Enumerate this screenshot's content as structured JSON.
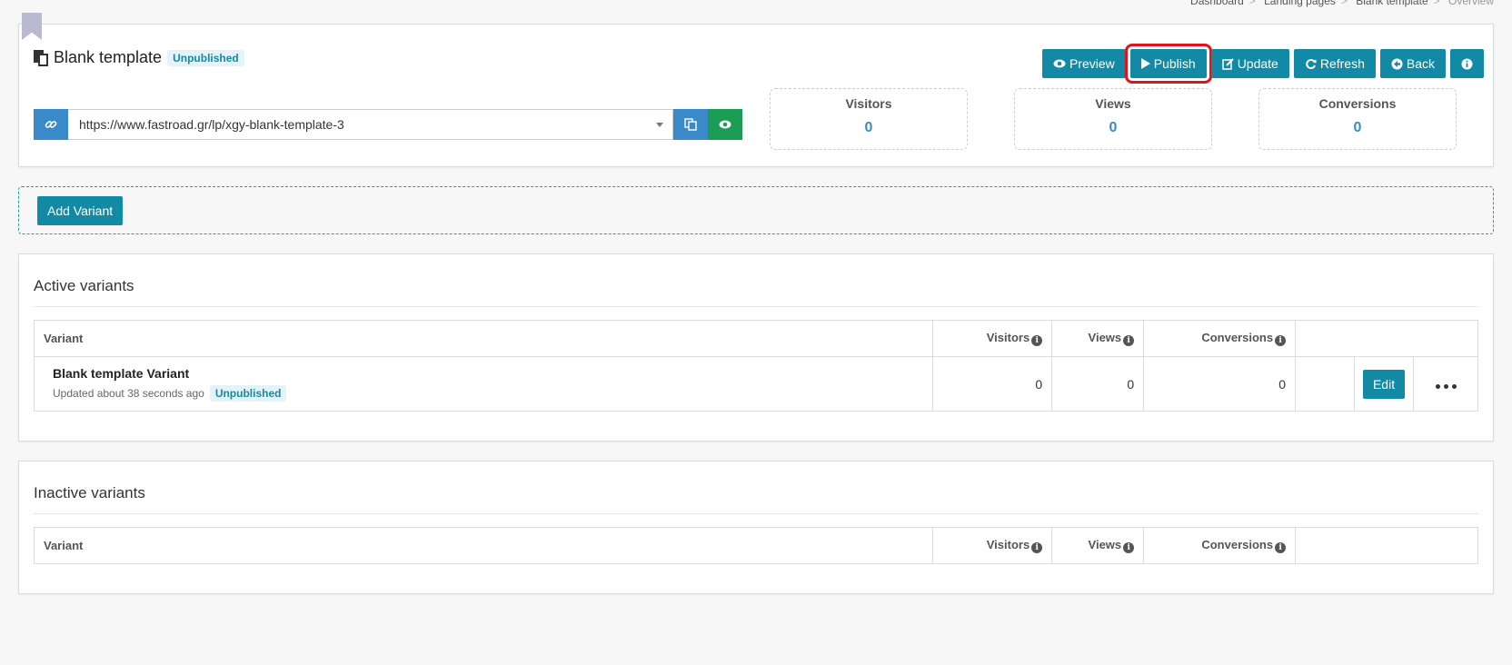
{
  "breadcrumb": [
    "Dashboard",
    "Landing pages",
    "Blank template",
    "Overview"
  ],
  "header": {
    "title": "Blank template",
    "status": "Unpublished",
    "buttons": {
      "preview": "Preview",
      "publish": "Publish",
      "update": "Update",
      "refresh": "Refresh",
      "back": "Back"
    },
    "url": "https://www.fastroad.gr/lp/xgy-blank-template-3"
  },
  "stats": [
    {
      "label": "Visitors",
      "value": "0"
    },
    {
      "label": "Views",
      "value": "0"
    },
    {
      "label": "Conversions",
      "value": "0"
    }
  ],
  "add_variant_label": "Add Variant",
  "columns": {
    "variant": "Variant",
    "visitors": "Visitors",
    "views": "Views",
    "conversions": "Conversions"
  },
  "active": {
    "title": "Active variants",
    "rows": [
      {
        "name": "Blank template Variant",
        "updated": "Updated about 38 seconds ago",
        "status": "Unpublished",
        "visitors": "0",
        "views": "0",
        "conversions": "0",
        "edit_label": "Edit"
      }
    ]
  },
  "inactive": {
    "title": "Inactive variants"
  },
  "colors": {
    "primary": "#128aa6",
    "link_blue": "#3a8ac9",
    "green": "#1b9d55",
    "highlight": "#e3131b"
  }
}
